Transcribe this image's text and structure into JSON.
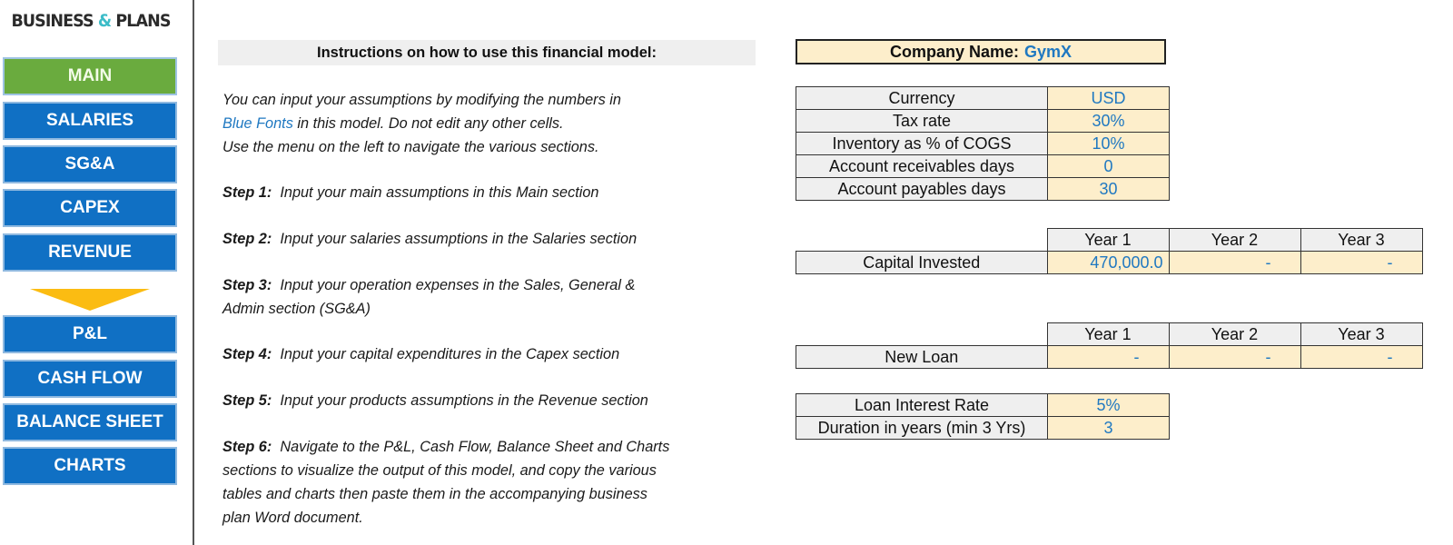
{
  "logo": {
    "part1": "BUSINESS",
    "amp": "&",
    "part2": "PLANS"
  },
  "sidebar": {
    "items": [
      {
        "label": "MAIN",
        "active": true
      },
      {
        "label": "SALARIES"
      },
      {
        "label": "SG&A"
      },
      {
        "label": "CAPEX"
      },
      {
        "label": "REVENUE"
      },
      {
        "label": "P&L"
      },
      {
        "label": "CASH FLOW"
      },
      {
        "label": "BALANCE SHEET"
      },
      {
        "label": "CHARTS"
      }
    ]
  },
  "instructions": {
    "title": "Instructions on how to use this financial model:",
    "intro_line1": "You can input your assumptions by modifying the numbers in",
    "intro_blue": "Blue Fonts",
    "intro_line2_rest": " in this model. Do not edit any other cells.",
    "intro_line3": "Use the menu on the left to navigate the various sections.",
    "steps": [
      {
        "label": "Step 1:",
        "text": "Input your main assumptions in this Main section"
      },
      {
        "label": "Step 2:",
        "text": "Input your salaries assumptions in the Salaries section"
      },
      {
        "label": "Step 3:",
        "text": "Input your operation expenses in the Sales, General &",
        "text2": "Admin section (SG&A)"
      },
      {
        "label": "Step 4:",
        "text": "Input your capital expenditures in the Capex section"
      },
      {
        "label": "Step 5:",
        "text": "Input your products assumptions in the Revenue section"
      },
      {
        "label": "Step 6:",
        "text": "Navigate to the P&L, Cash Flow, Balance Sheet and Charts",
        "text2": "sections to visualize the output of this model, and copy the various",
        "text3": "tables and charts then paste them in the accompanying business",
        "text4": "plan Word document."
      }
    ]
  },
  "company": {
    "label": "Company Name:",
    "value": "GymX"
  },
  "assumptions": [
    {
      "label": "Currency",
      "value": "USD"
    },
    {
      "label": "Tax rate",
      "value": "30%"
    },
    {
      "label": "Inventory as % of COGS",
      "value": "10%"
    },
    {
      "label": "Account receivables days",
      "value": "0"
    },
    {
      "label": "Account payables days",
      "value": "30"
    }
  ],
  "capital": {
    "years": [
      "Year 1",
      "Year 2",
      "Year 3"
    ],
    "label": "Capital Invested",
    "values": [
      "470,000.0",
      "-",
      "-"
    ]
  },
  "loan": {
    "years": [
      "Year 1",
      "Year 2",
      "Year 3"
    ],
    "label": "New Loan",
    "values": [
      "-",
      "-",
      "-"
    ]
  },
  "loan_terms": [
    {
      "label": "Loan Interest Rate",
      "value": "5%"
    },
    {
      "label": "Duration in years (min 3 Yrs)",
      "value": "3"
    }
  ]
}
